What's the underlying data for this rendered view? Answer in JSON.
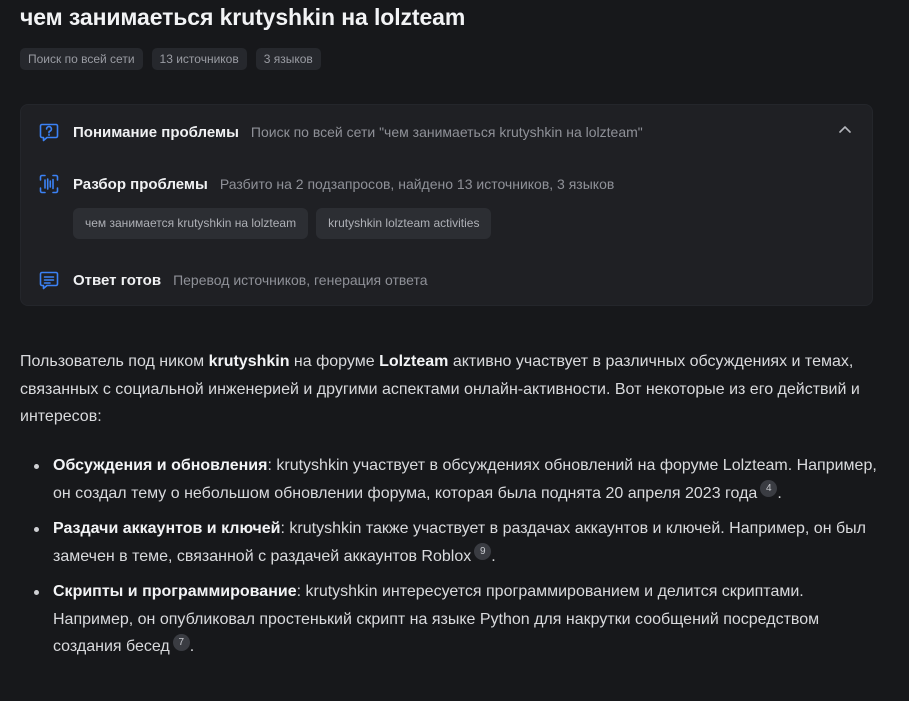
{
  "query_title": "чем занимаеться krutyshkin на lolzteam",
  "meta_chips": [
    "Поиск по всей сети",
    "13 источников",
    "3 языков"
  ],
  "steps": {
    "understanding": {
      "icon": "question-bubble-icon",
      "title": "Понимание проблемы",
      "desc": "Поиск по всей сети \"чем занимаеться krutyshkin на lolzteam\""
    },
    "analysis": {
      "icon": "scan-icon",
      "title": "Разбор проблемы",
      "desc": "Разбито на 2 подзапросов, найдено 13 источников, 3 языков",
      "subqueries": [
        "чем занимается krutyshkin на lolzteam",
        "krutyshkin lolzteam activities"
      ]
    },
    "ready": {
      "icon": "message-lines-icon",
      "title": "Ответ готов",
      "desc": "Перевод источников, генерация ответа"
    }
  },
  "answer": {
    "intro_1": "Пользователь под ником ",
    "intro_user": "krutyshkin",
    "intro_2": " на форуме ",
    "intro_forum": "Lolzteam",
    "intro_3": " активно участвует в различных обсуждениях и темах, связанных с социальной инженерией и другими аспектами онлайн-активности. Вот некоторые из его действий и интересов:",
    "bullets": [
      {
        "title": "Обсуждения и обновления",
        "text": ": krutyshkin участвует в обсуждениях обновлений на форуме Lolzteam. Например, он создал тему о небольшом обновлении форума, которая была поднята 20 апреля 2023 года",
        "cite": "4",
        "end": "."
      },
      {
        "title": "Раздачи аккаунтов и ключей",
        "text": ": krutyshkin также участвует в раздачах аккаунтов и ключей. Например, он был замечен в теме, связанной с раздачей аккаунтов Roblox",
        "cite": "9",
        "end": "."
      },
      {
        "title": "Скрипты и программирование",
        "text": ": krutyshkin интересуется программированием и делится скриптами. Например, он опубликовал простенький скрипт на языке Python для накрутки сообщений посредством создания бесед",
        "cite": "7",
        "end": "."
      }
    ]
  },
  "colors": {
    "accent": "#3b82f6",
    "background": "#17181b",
    "card": "#1f2024"
  }
}
